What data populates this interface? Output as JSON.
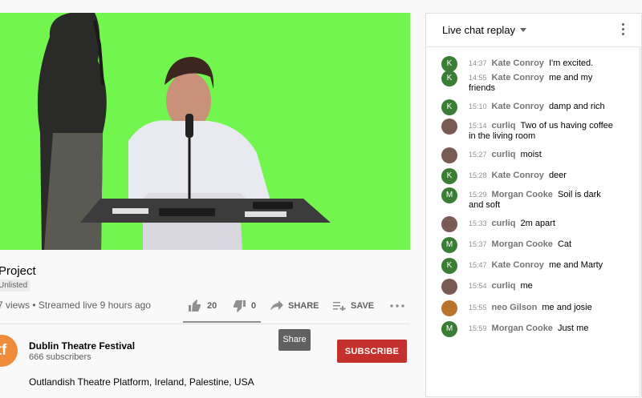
{
  "video": {
    "title": "Project",
    "visibility": "Unlisted",
    "meta": "7 views • Streamed live 9 hours ago",
    "likes": "20",
    "dislikes": "0",
    "like_fraction": 1.0,
    "share_label": "SHARE",
    "save_label": "SAVE",
    "tooltip": "Share",
    "colors": {
      "screen_green": "#72f54d",
      "subscribe_red": "#c4302b"
    }
  },
  "channel": {
    "avatar_text": "tf",
    "name": "Dublin Theatre Festival",
    "subscribers": "666 subscribers",
    "subscribe_label": "SUBSCRIBE",
    "description": "Outlandish Theatre Platform, Ireland, Palestine, USA"
  },
  "chat": {
    "title": "Live chat replay",
    "messages": [
      {
        "time": "14:37",
        "author": "Kate Conroy",
        "text": "I'm excited.",
        "avatar": "K",
        "avatar_color": "#3a7d35"
      },
      {
        "time": "14:55",
        "author": "Kate Conroy",
        "text": "me and my friends",
        "avatar": "K",
        "avatar_color": "#3a7d35"
      },
      {
        "time": "15:10",
        "author": "Kate Conroy",
        "text": "damp and rich",
        "avatar": "K",
        "avatar_color": "#3a7d35"
      },
      {
        "time": "15:14",
        "author": "curliq",
        "text": "Two of us having coffee in the living room",
        "avatar": "",
        "avatar_color": "#7a5a55"
      },
      {
        "time": "15:27",
        "author": "curliq",
        "text": "moist",
        "avatar": "",
        "avatar_color": "#7a5a55"
      },
      {
        "time": "15:28",
        "author": "Kate Conroy",
        "text": "deer",
        "avatar": "K",
        "avatar_color": "#3a7d35"
      },
      {
        "time": "15:29",
        "author": "Morgan Cooke",
        "text": "Soil is dark and soft",
        "avatar": "M",
        "avatar_color": "#3a7d35"
      },
      {
        "time": "15:33",
        "author": "curliq",
        "text": "2m apart",
        "avatar": "",
        "avatar_color": "#7a5a55"
      },
      {
        "time": "15:37",
        "author": "Morgan Cooke",
        "text": "Cat",
        "avatar": "M",
        "avatar_color": "#3a7d35"
      },
      {
        "time": "15:47",
        "author": "Kate Conroy",
        "text": "me and Marty",
        "avatar": "K",
        "avatar_color": "#3a7d35"
      },
      {
        "time": "15:54",
        "author": "curliq",
        "text": "me",
        "avatar": "",
        "avatar_color": "#7a5a55"
      },
      {
        "time": "15:55",
        "author": "neo Gilson",
        "text": "me and josie",
        "avatar": "",
        "avatar_color": "#b8742a"
      },
      {
        "time": "15:59",
        "author": "Morgan Cooke",
        "text": "Just me",
        "avatar": "M",
        "avatar_color": "#3a7d35"
      }
    ]
  }
}
